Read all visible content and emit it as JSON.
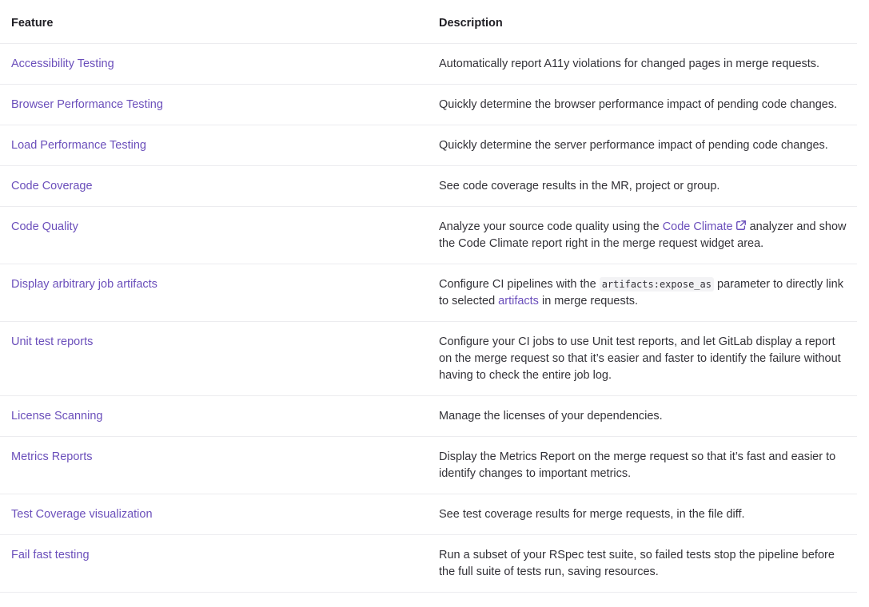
{
  "headers": {
    "feature": "Feature",
    "description": "Description"
  },
  "rows": [
    {
      "feature": "Accessibility Testing",
      "desc": "Automatically report A11y violations for changed pages in merge requests."
    },
    {
      "feature": "Browser Performance Testing",
      "desc": "Quickly determine the browser performance impact of pending code changes."
    },
    {
      "feature": "Load Performance Testing",
      "desc": "Quickly determine the server performance impact of pending code changes."
    },
    {
      "feature": "Code Coverage",
      "desc": "See code coverage results in the MR, project or group."
    },
    {
      "feature": "Code Quality",
      "desc_pre": "Analyze your source code quality using the ",
      "desc_link": "Code Climate",
      "desc_post": " analyzer and show the Code Climate report right in the merge request widget area."
    },
    {
      "feature": "Display arbitrary job artifacts",
      "desc_pre": "Configure CI pipelines with the ",
      "desc_code": "artifacts:expose_as",
      "desc_mid": " parameter to directly link to selected ",
      "desc_link": "artifacts",
      "desc_post": " in merge requests."
    },
    {
      "feature": "Unit test reports",
      "desc": "Configure your CI jobs to use Unit test reports, and let GitLab display a report on the merge request so that it’s easier and faster to identify the failure without having to check the entire job log."
    },
    {
      "feature": "License Scanning",
      "desc": "Manage the licenses of your dependencies."
    },
    {
      "feature": "Metrics Reports",
      "desc": "Display the Metrics Report on the merge request so that it’s fast and easier to identify changes to important metrics."
    },
    {
      "feature": "Test Coverage visualization",
      "desc": "See test coverage results for merge requests, in the file diff."
    },
    {
      "feature": "Fail fast testing",
      "desc": "Run a subset of your RSpec test suite, so failed tests stop the pipeline before the full suite of tests run, saving resources."
    }
  ],
  "colors": {
    "link": "#6b4fbb",
    "text": "#333238",
    "border": "#ececef"
  },
  "icons": {
    "external_link": "external-link-icon"
  }
}
